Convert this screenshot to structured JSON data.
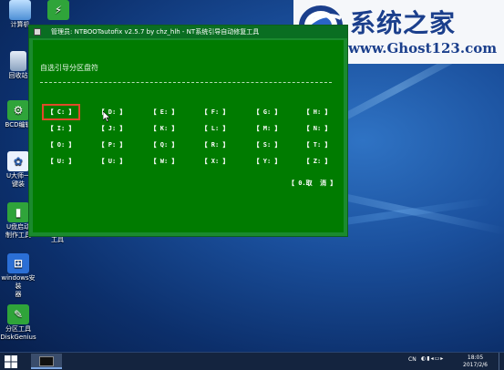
{
  "desktop": {
    "icons": [
      {
        "label": "计算机",
        "icon": "computer-icon"
      },
      {
        "label": "回收站",
        "icon": "recycle-bin-icon"
      },
      {
        "label": "BCD编辑",
        "icon": "bcd-editor-icon"
      },
      {
        "label": "U大师一\n键装",
        "icon": "udashi-icon"
      },
      {
        "label": "U盘启动\n制作工具",
        "icon": "usb-boot-icon"
      },
      {
        "label": "windows安装\n器",
        "icon": "windows-installer-icon"
      },
      {
        "label": "分区工具\nDiskGenius",
        "icon": "diskgenius-icon"
      }
    ],
    "second_col_label": "工具"
  },
  "watermark": {
    "title": "系统之家",
    "url": "www.Ghost123.com"
  },
  "window": {
    "title": "管理员:  NTBOOTautofix v2.5.7 by chz_hlh - NT系统引导自动修复工具",
    "heading": "自选引导分区盘符",
    "drives": [
      [
        "【 C: 】",
        "【 D: 】",
        "【 E: 】",
        "【 F: 】",
        "【 G: 】",
        "【 H: 】"
      ],
      [
        "【 I: 】",
        "【 J: 】",
        "【 K: 】",
        "【 L: 】",
        "【 M: 】",
        "【 N: 】"
      ],
      [
        "【 O: 】",
        "【 P: 】",
        "【 Q: 】",
        "【 R: 】",
        "【 S: 】",
        "【 T: 】"
      ],
      [
        "【 U: 】",
        "【 U: 】",
        "【 W: 】",
        "【 X: 】",
        "【 Y: 】",
        "【 Z: 】"
      ]
    ],
    "selected": "C:",
    "cancel_label": "【 0.取  消 】"
  },
  "taskbar": {
    "lang": "CN",
    "time": "18:05",
    "date": "2017/2/6"
  },
  "colors": {
    "window_bg": "#007b00",
    "titlebar_bg": "#0a6e22",
    "selection": "#e04a2a",
    "taskbar_bg": "#14243f"
  }
}
